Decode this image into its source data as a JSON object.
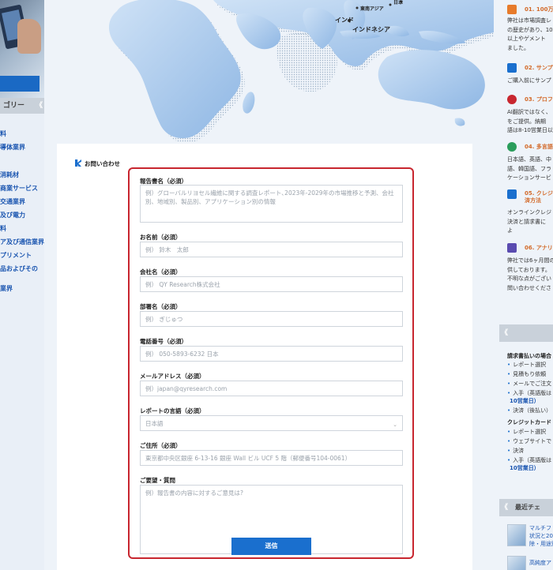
{
  "map": {
    "labels": [
      "インド",
      "インドネシア",
      "東南アジア",
      "日本"
    ]
  },
  "sidebar": {
    "category_header": "ゴリー",
    "items": [
      "料",
      "導体業界",
      "消耗材",
      "商業サービス",
      "交通業界",
      "及び電力",
      "料",
      "ア及び通信業界",
      "プリメント",
      "品およびその",
      "業界"
    ]
  },
  "form": {
    "section_title": "お問い合わせ",
    "fields": [
      {
        "label": "報告書名（必須）",
        "placeholder": "例）グローバルリヨセル繊維に関する調査レポート､2023年-2029年の市場推移と予測、会社別、地域別、製品別、アプリケーション別の情報"
      },
      {
        "label": "お名前（必須）",
        "placeholder": "例） 鈴木　太郎"
      },
      {
        "label": "会社名（必須）",
        "placeholder": "例） QY Research株式会社"
      },
      {
        "label": "部署名（必須）",
        "placeholder": "例） ぎじゅつ"
      },
      {
        "label": "電話番号（必須）",
        "placeholder": "例） 050-5893-6232 日本"
      },
      {
        "label": "メールアドレス（必須）",
        "placeholder": "例）japan@qyresearch.com"
      },
      {
        "label": "レポートの言語（必須）",
        "value": "日本語"
      },
      {
        "label": "ご住所（必須）",
        "placeholder": "東京都中央区銀座 6-13-16 銀座 Wall ビル UCF 5 階（郵便番号104-0061）"
      },
      {
        "label": "ご要望・質問",
        "placeholder": "例）報告書の内容に対するご意見は?"
      }
    ],
    "submit_label": "送信"
  },
  "right": {
    "features": [
      {
        "title": "01. 100万",
        "text": "弊社は市場調査レ\nの歴史があり、10\n以上やゲメント\nました。",
        "color": "#e77b2b"
      },
      {
        "title": "02. サンプ",
        "text": "ご購入前にサンプ",
        "color": "#1a6fce"
      },
      {
        "title": "03. プロフ",
        "text": "AI翻訳ではなく、\nをご提供。納期\n語は8-10営業日以",
        "color": "#c8262f"
      },
      {
        "title": "04. 多言語",
        "text": "日本語、英語、中\n語、韓国語、フラ\nケーションサービ",
        "color": "#2a9d5b"
      },
      {
        "title": "05. クレジ\n済方法",
        "text": "オンラインクレジ\n決済と請求書に\nよ",
        "color": "#1a6fce"
      },
      {
        "title": "06. アナリ",
        "text": "弊社では6ヶ月間の\n供しております。\n不明な点がござい\n問い合わせくださ",
        "color": "#5a4bb0"
      }
    ],
    "payment_header": "",
    "payment_invoice_title": "請求書払いの場合",
    "payment_invoice_items": [
      "レポート選択",
      "見積もり依頼",
      "メールでご注文",
      "入手（英語版は",
      "10営業日）",
      "決済（後払い）"
    ],
    "payment_card_title": "クレジットカード",
    "payment_card_items": [
      "レポート選択",
      "ウェブサイトで",
      "決済",
      "入手（英語版は",
      "10営業日）"
    ],
    "recent_header": "最近チェ",
    "recent_items": [
      "マルチフ\n状況と20\n除・用途別",
      "高純度ア"
    ]
  }
}
